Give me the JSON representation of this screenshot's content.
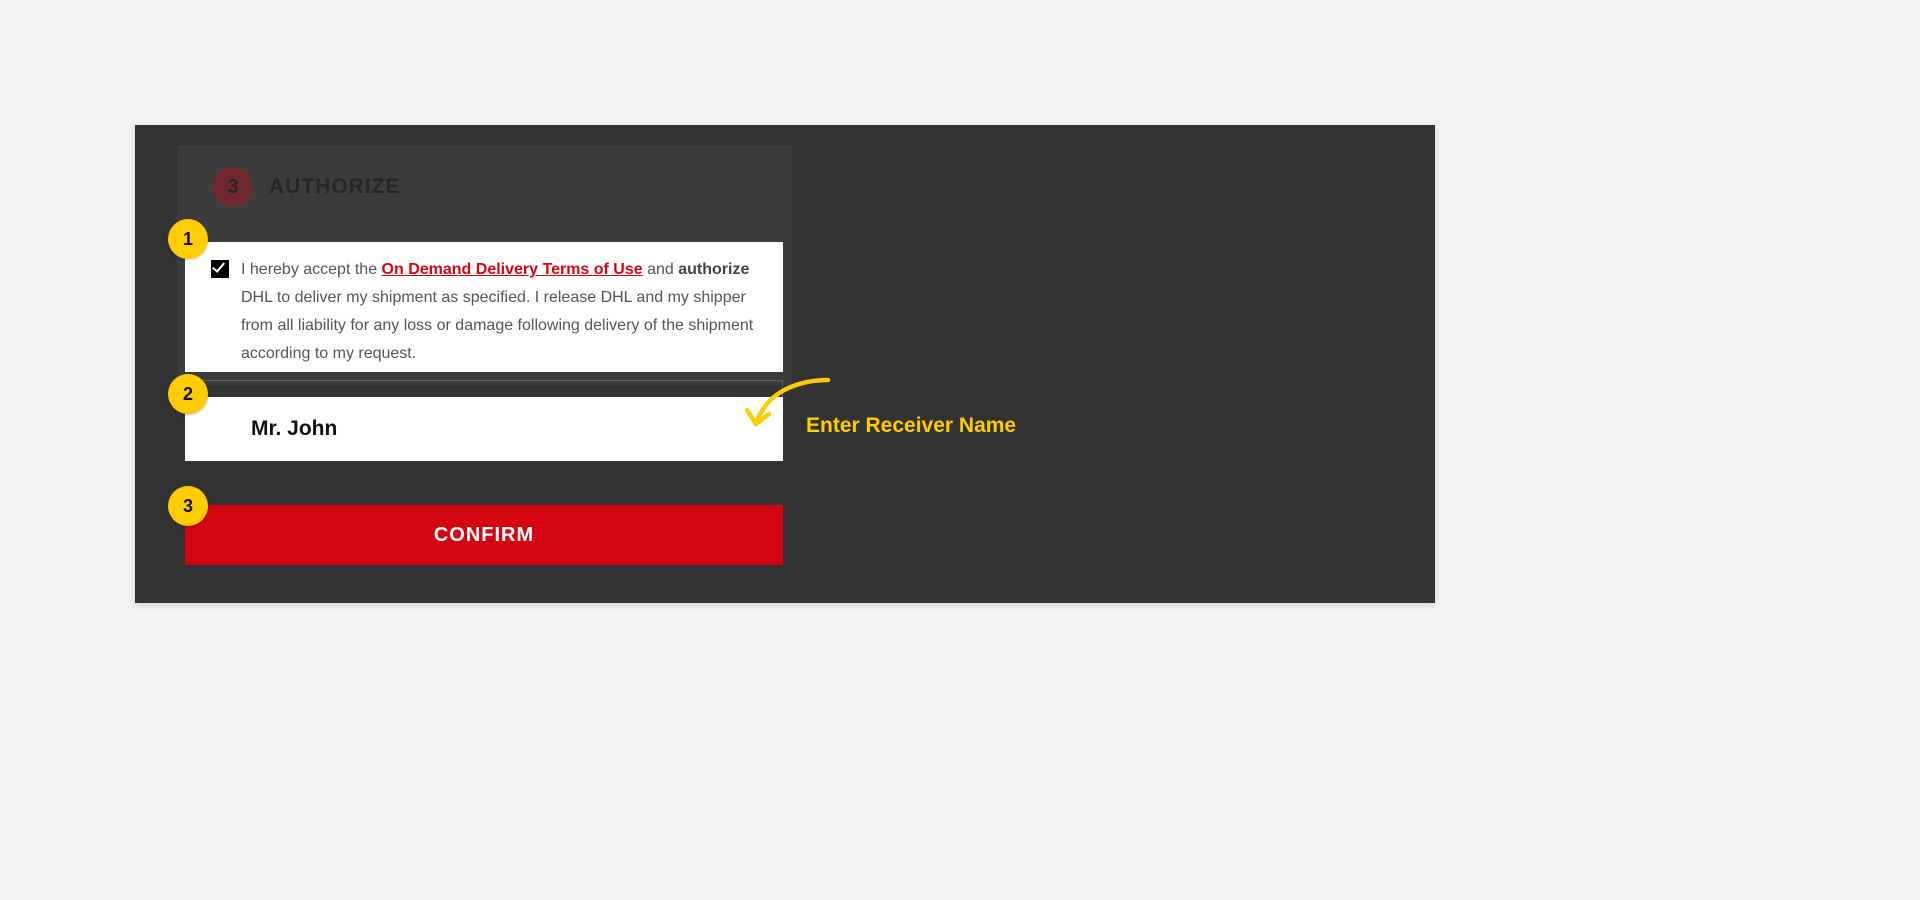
{
  "step": {
    "number": "3",
    "title": "AUTHORIZE"
  },
  "terms": {
    "prefix": "I hereby accept the ",
    "link": "On Demand Delivery Terms of Use",
    "mid1": " and ",
    "bold": "authorize",
    "rest": " DHL to deliver my shipment as specified. I release DHL and my shipper from all liability for any loss or damage following delivery of the shipment according to my request."
  },
  "receiver": {
    "value": "Mr. John"
  },
  "confirm": {
    "label": "CONFIRM"
  },
  "annotations": {
    "badge1": "1",
    "badge2": "2",
    "badge3": "3",
    "receiver_hint": "Enter Receiver Name"
  },
  "colors": {
    "brand_red": "#d40511",
    "accent_yellow": "#ffcc00"
  }
}
